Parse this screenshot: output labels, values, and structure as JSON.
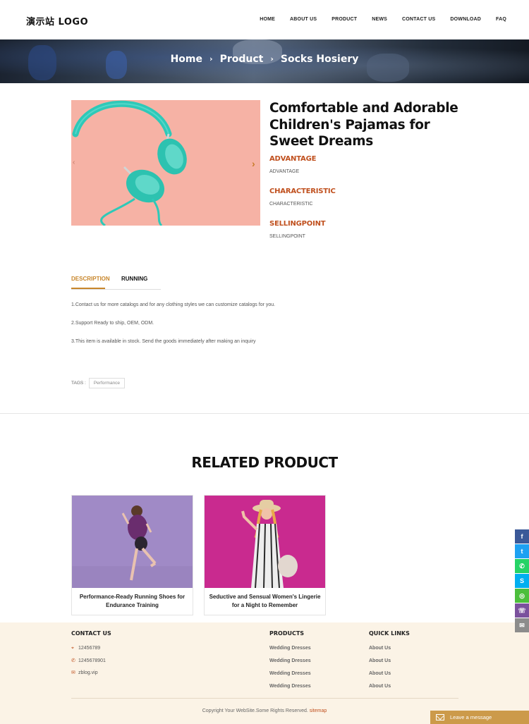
{
  "header": {
    "logo": "演示站 LOGO",
    "nav": [
      "HOME",
      "ABOUT US",
      "PRODUCT",
      "NEWS",
      "CONTACT US",
      "DOWNLOAD",
      "FAQ"
    ]
  },
  "breadcrumb": {
    "items": [
      "Home",
      "Product",
      "Socks Hosiery"
    ],
    "separator": "›"
  },
  "product": {
    "title": "Comfortable and Adorable Children's Pajamas for Sweet Dreams",
    "attributes": [
      {
        "heading": "ADVANTAGE",
        "value": "ADVANTAGE"
      },
      {
        "heading": "CHARACTERISTIC",
        "value": "CHARACTERISTIC"
      },
      {
        "heading": "SELLINGPOINT",
        "value": "SELLINGPOINT"
      }
    ],
    "next_icon": "›",
    "prev_icon": "‹"
  },
  "tabs": {
    "items": [
      "DESCRIPTION",
      "RUNNING"
    ],
    "active": "DESCRIPTION"
  },
  "description": [
    "1.Contact us for more catalogs and for any clothing styles we can customize catalogs for you.",
    "2.Support Ready to ship, OEM, ODM.",
    "3.This item is available in stock. Send the goods immediately after making an inquiry"
  ],
  "tags": {
    "label": "TAGS :",
    "items": [
      "Performance"
    ]
  },
  "related": {
    "title": "RELATED PRODUCT",
    "items": [
      {
        "caption": "Performance-Ready Running Shoes for Endurance Training"
      },
      {
        "caption": "Seductive and Sensual Women's Lingerie for a Night to Remember"
      }
    ]
  },
  "footer": {
    "contact": {
      "heading": "CONTACT US",
      "items": [
        {
          "icon": "location-icon",
          "text": "12456789"
        },
        {
          "icon": "phone-icon",
          "text": "1245678901"
        },
        {
          "icon": "mail-icon",
          "text": "zblog.vip"
        }
      ]
    },
    "products": {
      "heading": "PRODUCTS",
      "links": [
        "Wedding Dresses",
        "Wedding Dresses",
        "Wedding Dresses",
        "Wedding Dresses"
      ]
    },
    "quick_links": {
      "heading": "QUICK LINKS",
      "links": [
        "About Us",
        "About Us",
        "About Us",
        "About Us"
      ]
    },
    "copyright": "Copyright Your WebSite.Some Rights Reserved.",
    "sitemap": "sitemap"
  },
  "social": [
    {
      "icon": "facebook-icon",
      "glyph": "f",
      "color": "#3b5998"
    },
    {
      "icon": "twitter-icon",
      "glyph": "t",
      "color": "#1da1f2"
    },
    {
      "icon": "whatsapp-icon",
      "glyph": "✆",
      "color": "#25d366"
    },
    {
      "icon": "skype-icon",
      "glyph": "S",
      "color": "#00aff0"
    },
    {
      "icon": "wechat-icon",
      "glyph": "◎",
      "color": "#4cbf3c"
    },
    {
      "icon": "viber-icon",
      "glyph": "☏",
      "color": "#7b519d"
    },
    {
      "icon": "email-icon",
      "glyph": "✉",
      "color": "#8c8c8c"
    }
  ],
  "leave_message": "Leave a message",
  "colors": {
    "accent": "#c0501e",
    "tab_active": "#c8862b",
    "footer_bg": "#fbf3e6",
    "leave_bg": "#cc9a4a"
  }
}
